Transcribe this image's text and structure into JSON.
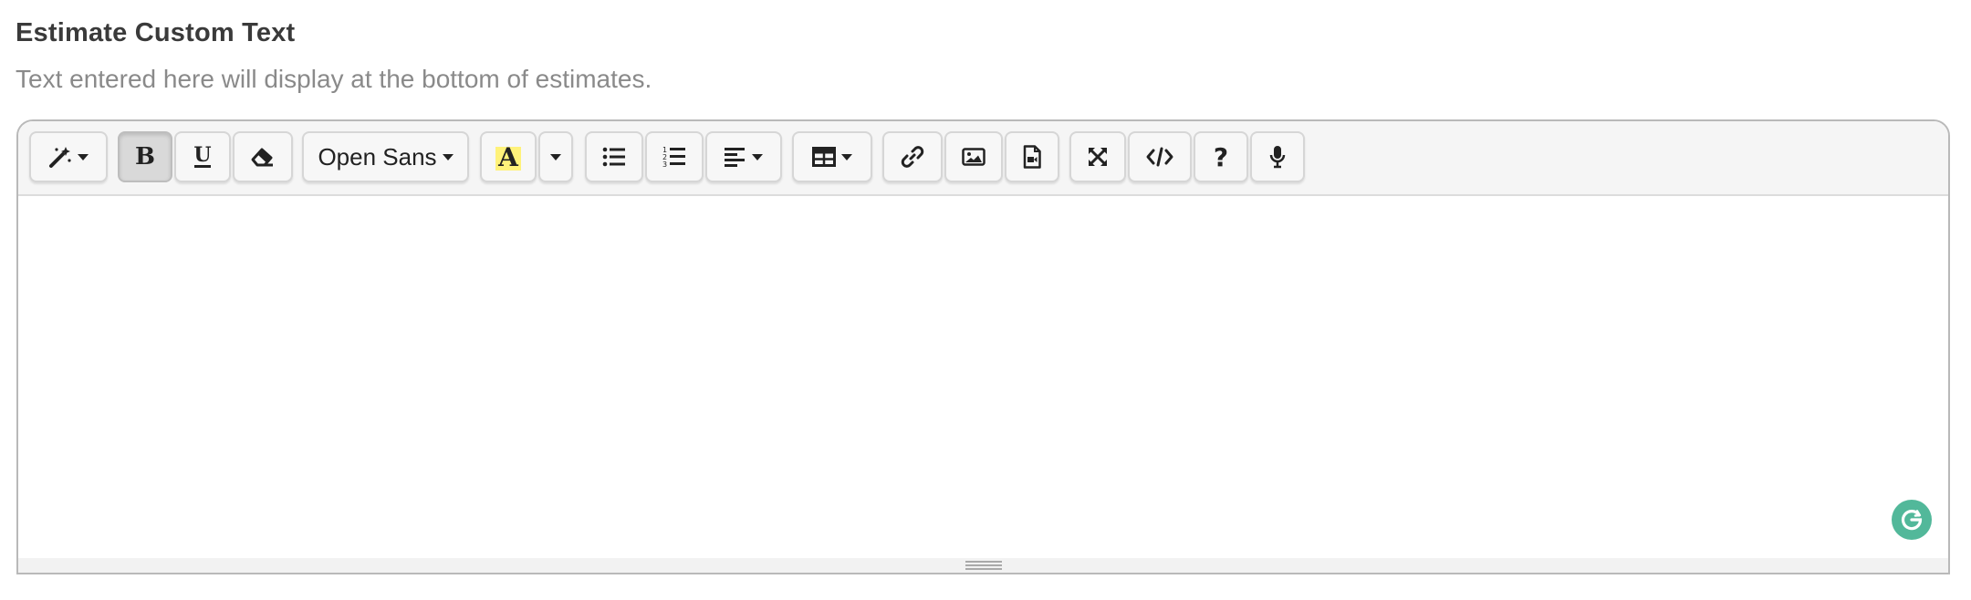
{
  "section": {
    "title": "Estimate Custom Text",
    "subtitle": "Text entered here will display at the bottom of estimates."
  },
  "toolbar": {
    "font_name": "Open Sans",
    "highlight_letter": "A",
    "highlight_color": "#fff27a"
  },
  "editor": {
    "content": ""
  },
  "colors": {
    "grammarly": "#52b89a",
    "toolbar_bg": "#f5f5f5"
  }
}
